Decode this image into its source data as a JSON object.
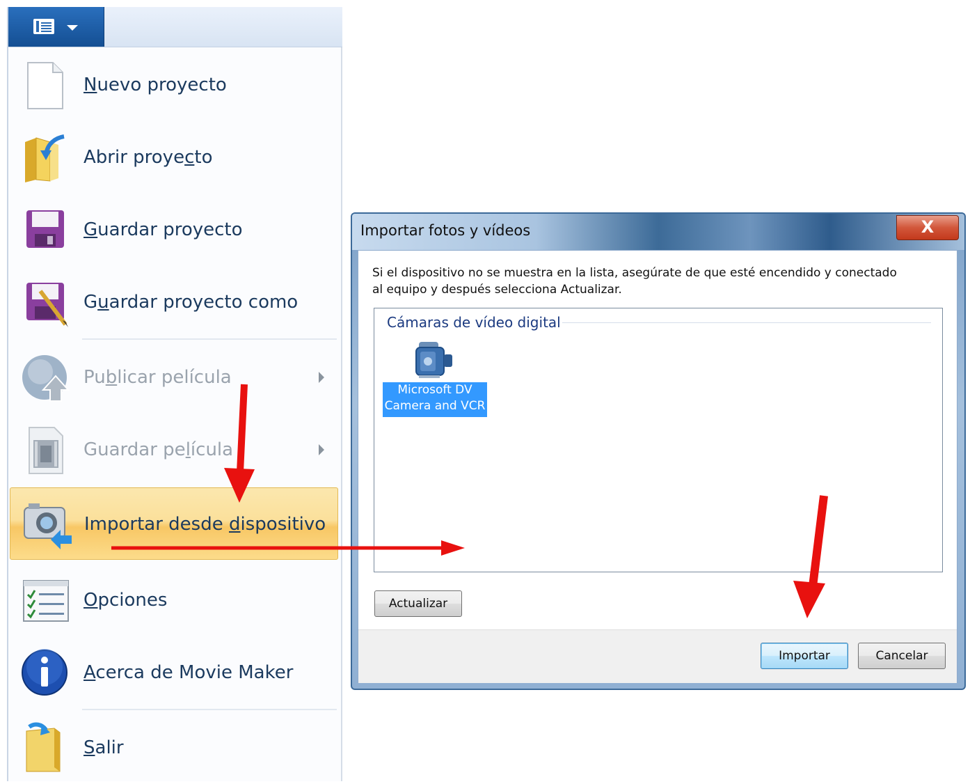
{
  "menu": {
    "items": [
      {
        "id": "new",
        "pre": "",
        "acc": "N",
        "post": "uevo proyecto",
        "disabled": false
      },
      {
        "id": "open",
        "pre": "Abrir proye",
        "acc": "c",
        "post": "to",
        "disabled": false
      },
      {
        "id": "save",
        "pre": "",
        "acc": "G",
        "post": "uardar proyecto",
        "disabled": false
      },
      {
        "id": "saveas",
        "pre": "G",
        "acc": "u",
        "post": "ardar proyecto como",
        "disabled": false
      },
      {
        "id": "publish",
        "pre": "Pu",
        "acc": "b",
        "post": "licar película",
        "disabled": true
      },
      {
        "id": "savemovie",
        "pre": "Guardar pe",
        "acc": "l",
        "post": "ícula",
        "disabled": true
      },
      {
        "id": "import",
        "pre": "Importar desde ",
        "acc": "d",
        "post": "ispositivo",
        "disabled": false
      },
      {
        "id": "options",
        "pre": "",
        "acc": "O",
        "post": "pciones",
        "disabled": false
      },
      {
        "id": "about",
        "pre": "",
        "acc": "A",
        "post": "cerca de Movie Maker",
        "disabled": false
      },
      {
        "id": "exit",
        "pre": "",
        "acc": "S",
        "post": "alir",
        "disabled": false
      }
    ]
  },
  "dialog": {
    "title": "Importar fotos y vídeos",
    "close": "X",
    "instructions_line1": "Si el dispositivo no se muestra en la lista, asegúrate de que esté encendido y conectado",
    "instructions_line2": "al equipo y después selecciona Actualizar.",
    "group_header": "Cámaras de vídeo digital",
    "device_line1": "Microsoft DV",
    "device_line2": "Camera and VCR",
    "refresh_label": "Actualizar",
    "import_label": "Importar",
    "cancel_label": "Cancelar"
  },
  "colors": {
    "annotation_arrow": "#e8110f",
    "highlight": "#f8c765",
    "selection": "#3399ff"
  },
  "icons": {
    "new": "blank-document-icon",
    "open": "open-folder-icon",
    "save": "floppy-disk-icon",
    "saveas": "floppy-disk-edit-icon",
    "publish": "globe-upload-icon",
    "savemovie": "film-document-icon",
    "import": "camera-import-icon",
    "options": "checklist-icon",
    "about": "info-icon",
    "exit": "exit-folder-icon"
  }
}
